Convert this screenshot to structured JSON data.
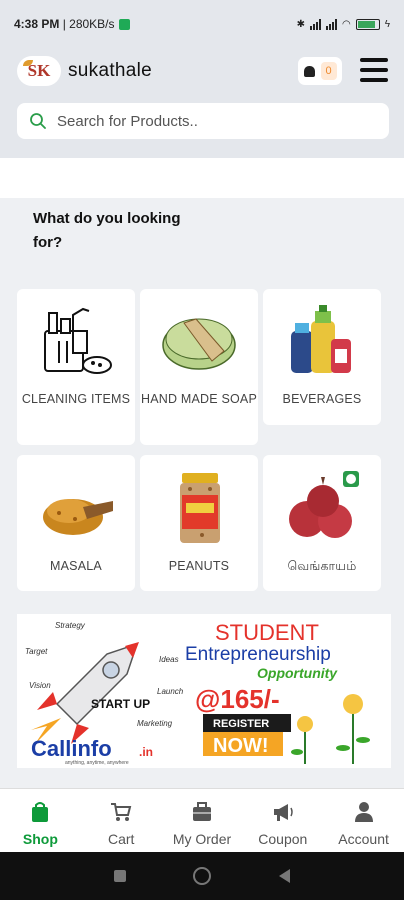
{
  "status_bar": {
    "time": "4:38 PM",
    "speed": "280KB/s",
    "battery_level": 0.85
  },
  "app": {
    "brand": "sukathale",
    "logo_text": "SK",
    "notification_count": "0"
  },
  "search": {
    "placeholder": "Search for Products.."
  },
  "section": {
    "title": "What do you looking for?"
  },
  "categories": [
    {
      "label": "CLEANING ITEMS",
      "icon": "cleaning-supplies-icon"
    },
    {
      "label": "HAND MADE SOAP",
      "icon": "soap-icon"
    },
    {
      "label": "BEVERAGES",
      "icon": "beverage-bottles-icon"
    },
    {
      "label": "MASALA",
      "icon": "masala-spice-icon"
    },
    {
      "label": "PEANUTS",
      "icon": "peanut-jar-icon"
    },
    {
      "label": "வெங்காயம்",
      "icon": "onion-icon"
    }
  ],
  "banner": {
    "headline": "STUDENT",
    "sub": "Entrepreneurship",
    "tag": "Opportunity",
    "price": "@165/-",
    "cta_line1": "REGISTER",
    "cta_line2": "NOW!",
    "rocket_text": "START UP",
    "brand": "Callinfo",
    "brand_suffix": ".in",
    "brand_tagline": "anything, anytime, anywhere",
    "doodles": [
      "Strategy",
      "Target",
      "Ideas",
      "Vision",
      "Launch",
      "Marketing"
    ]
  },
  "tabbar": {
    "tabs": [
      {
        "label": "Shop",
        "active": true
      },
      {
        "label": "Cart",
        "active": false
      },
      {
        "label": "My Order",
        "active": false
      },
      {
        "label": "Coupon",
        "active": false
      },
      {
        "label": "Account",
        "active": false
      }
    ]
  },
  "colors": {
    "accent": "#0e9a3a",
    "header_bg": "#e4e7ec",
    "banner_red": "#e4322b",
    "banner_blue": "#1b3ea6"
  }
}
